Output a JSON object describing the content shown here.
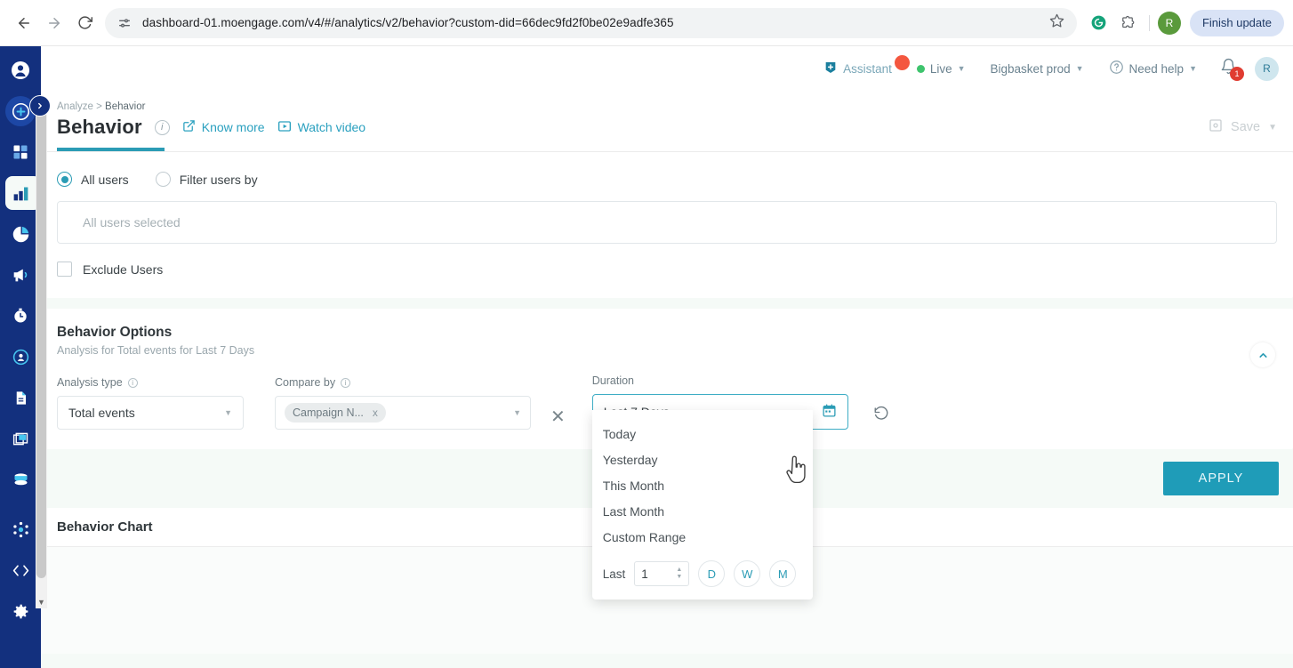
{
  "browser": {
    "back_icon": "back-arrow",
    "forward_icon": "forward-arrow",
    "reload_icon": "reload",
    "url": "dashboard-01.moengage.com/v4/#/analytics/v2/behavior?custom-did=66dec9fd2f0be02e9adfe365",
    "bookmark_icon": "star",
    "extension_grammarly_icon": "grammarly",
    "extensions_icon": "puzzle-piece",
    "profile_initial": "R",
    "update_button": "Finish update"
  },
  "rail": {
    "items": [
      {
        "name": "profile",
        "icon": "user-circle"
      },
      {
        "name": "create",
        "icon": "plus-circle"
      },
      {
        "name": "dashboard",
        "icon": "grid"
      },
      {
        "name": "analytics",
        "icon": "bar-chart",
        "active": true
      },
      {
        "name": "segments",
        "icon": "pie-chart"
      },
      {
        "name": "campaigns",
        "icon": "megaphone"
      },
      {
        "name": "realtime",
        "icon": "stopwatch"
      },
      {
        "name": "users",
        "icon": "user-target"
      },
      {
        "name": "content",
        "icon": "document"
      },
      {
        "name": "cards",
        "icon": "layers"
      },
      {
        "name": "data",
        "icon": "database"
      },
      {
        "name": "integrations",
        "icon": "hub"
      },
      {
        "name": "developer",
        "icon": "code"
      },
      {
        "name": "settings",
        "icon": "gear"
      }
    ],
    "expand_icon": "chevron-right"
  },
  "topnav": {
    "assistant_label": "Assistant",
    "assistant_badge": "",
    "live_label": "Live",
    "workspace_label": "Bigbasket prod",
    "help_label": "Need help",
    "notification_count": "1",
    "avatar_initial": "R"
  },
  "header": {
    "breadcrumb_root": "Analyze",
    "breadcrumb_sep": ">",
    "breadcrumb_current": "Behavior",
    "title": "Behavior",
    "know_more": "Know more",
    "watch_video": "Watch video",
    "save_label": "Save"
  },
  "user_filter": {
    "all_users_label": "All users",
    "filter_users_label": "Filter users by",
    "selection_placeholder": "All users selected",
    "exclude_label": "Exclude Users"
  },
  "behavior_options": {
    "title": "Behavior Options",
    "subtitle": "Analysis for Total events for Last 7 Days",
    "analysis_type_label": "Analysis type",
    "analysis_type_value": "Total events",
    "compare_by_label": "Compare by",
    "compare_by_chip": "Campaign N...",
    "chip_remove": "x",
    "clear_icon": "close-x",
    "duration_label": "Duration",
    "duration_value": "Last 7 Days",
    "calendar_icon": "calendar",
    "reset_icon": "reset-arrow",
    "collapse_icon": "chevron-up"
  },
  "duration_menu": {
    "options": [
      "Today",
      "Yesterday",
      "This Month",
      "Last Month",
      "Custom Range"
    ],
    "last_label": "Last",
    "last_value": "1",
    "units": [
      "D",
      "W",
      "M"
    ]
  },
  "apply": {
    "label": "APPLY"
  },
  "chart": {
    "title": "Behavior Chart"
  },
  "colors": {
    "accent_teal": "#2b9cb5",
    "apply_bg": "#1f9cb8",
    "rail_blue": "#13307e",
    "live_green": "#3ec46d",
    "badge_red": "#e03c31"
  }
}
